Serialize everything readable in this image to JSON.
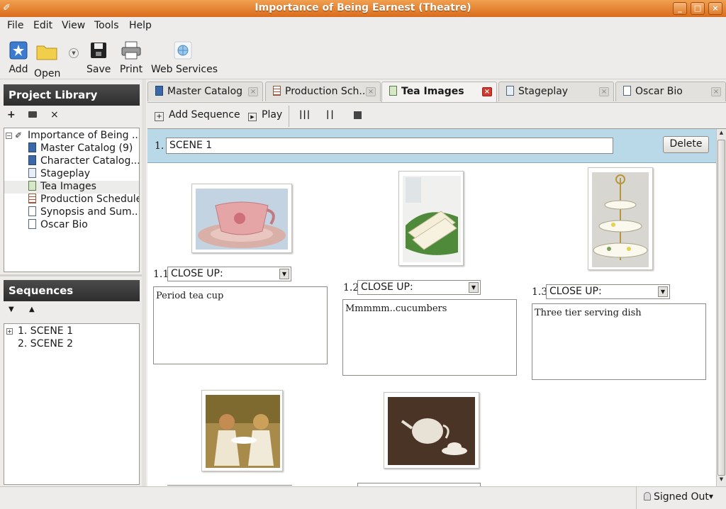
{
  "window": {
    "title": "Importance of Being Earnest (Theatre)",
    "min": "_",
    "max": "□",
    "close": "×"
  },
  "menu": [
    "File",
    "Edit",
    "View",
    "Tools",
    "Help"
  ],
  "toolbar": {
    "add": "Add",
    "open": "Open",
    "save": "Save",
    "print": "Print",
    "web": "Web Services"
  },
  "library": {
    "title": "Project Library",
    "root": "Importance of Being ...",
    "items": [
      "Master Catalog (9)",
      "Character Catalog...",
      "Stageplay",
      "Tea Images",
      "Production Schedule",
      "Synopsis and Sum...",
      "Oscar Bio"
    ]
  },
  "sequences": {
    "title": "Sequences",
    "items": [
      "1. SCENE 1",
      "2. SCENE 2"
    ]
  },
  "tabs": [
    "Master Catalog",
    "Production Sch...",
    "Tea Images",
    "Stageplay",
    "Oscar Bio"
  ],
  "seqtoolbar": {
    "add": "Add Sequence",
    "play": "Play"
  },
  "scene": {
    "num": "1.",
    "name": "SCENE 1",
    "delete": "Delete"
  },
  "shots": [
    {
      "num": "1.1",
      "type": "CLOSE UP:",
      "text": "Period tea cup"
    },
    {
      "num": "1.2",
      "type": "CLOSE UP:",
      "text": "Mmmmm..cucumbers"
    },
    {
      "num": "1.3",
      "type": "CLOSE UP:",
      "text": "Three tier serving dish"
    }
  ],
  "status": {
    "signed": "Signed Out"
  }
}
